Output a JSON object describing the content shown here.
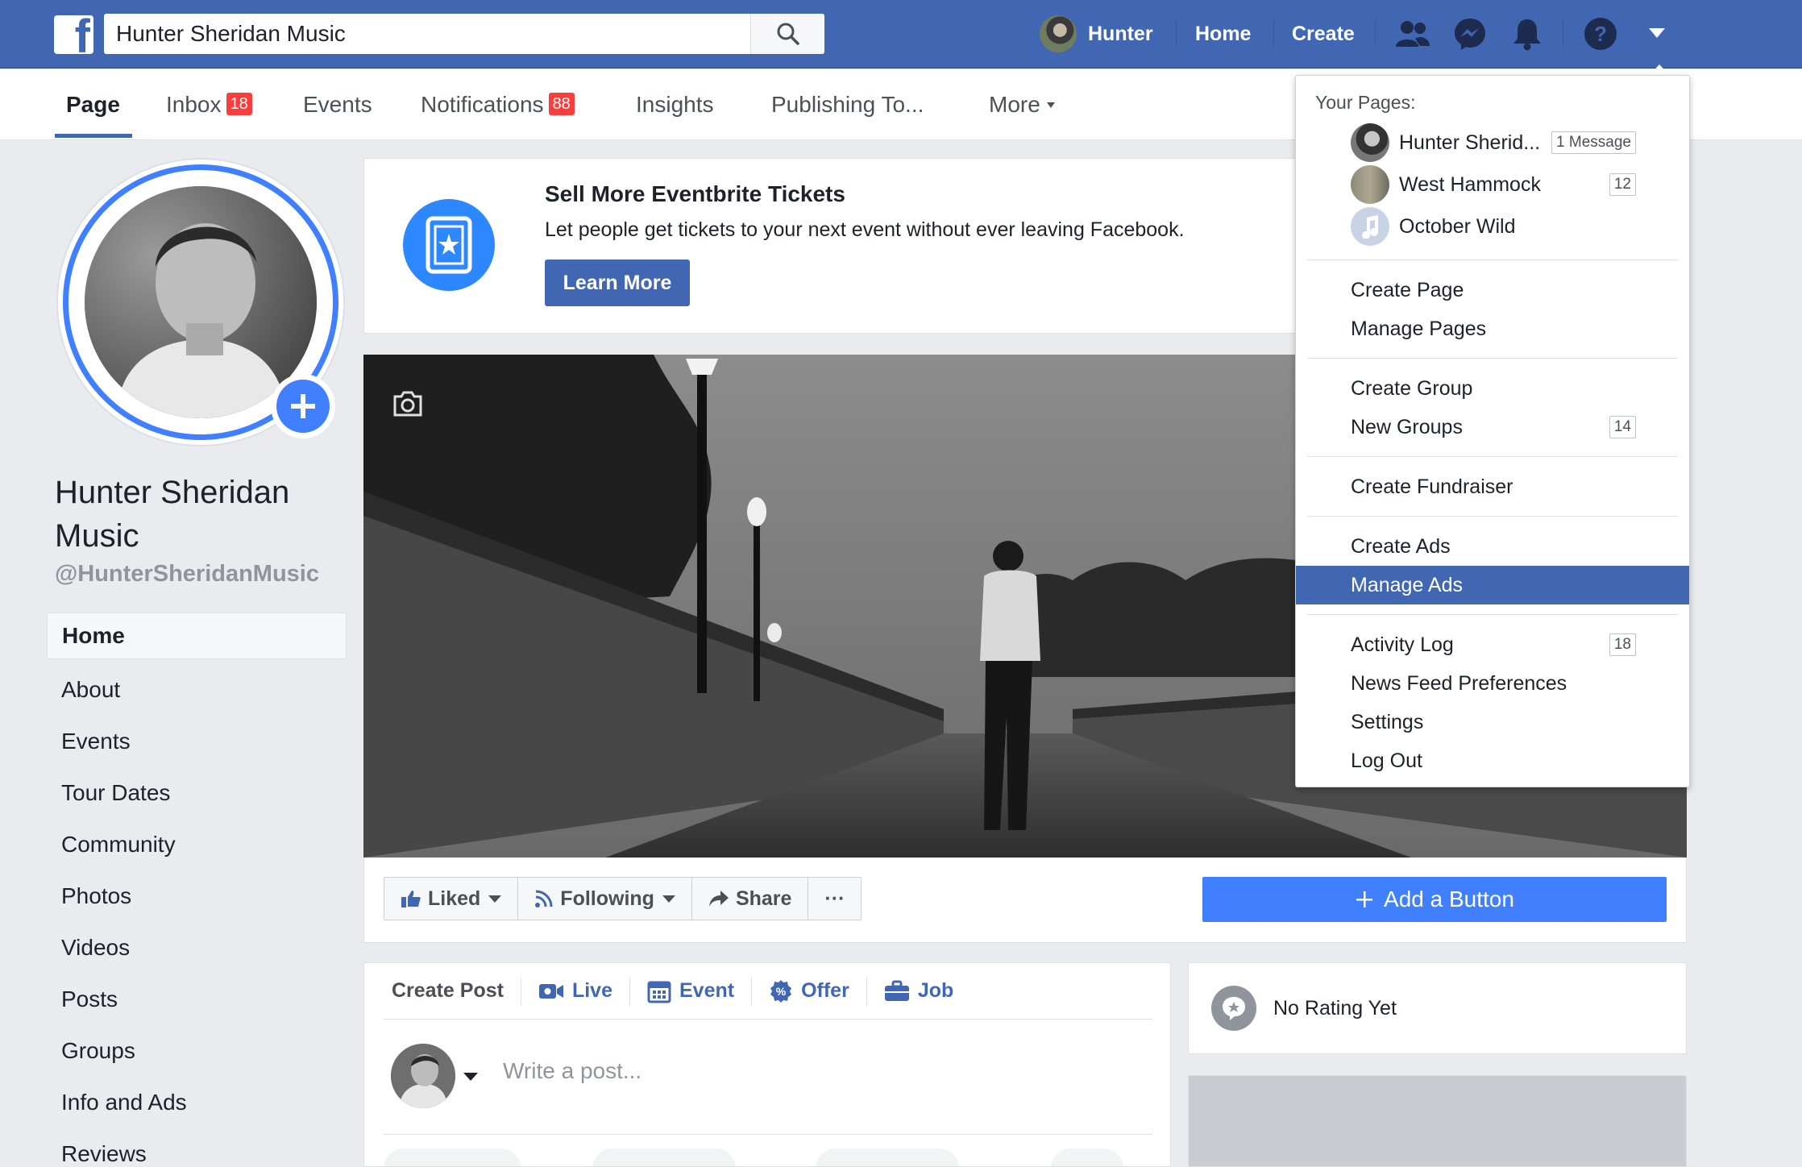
{
  "topbar": {
    "search_value": "Hunter Sheridan Music",
    "user_name": "Hunter",
    "home_label": "Home",
    "create_label": "Create"
  },
  "page_tabs": {
    "page": "Page",
    "inbox": "Inbox",
    "inbox_badge": "18",
    "events": "Events",
    "notifications": "Notifications",
    "notifications_badge": "88",
    "insights": "Insights",
    "publishing": "Publishing To...",
    "more": "More"
  },
  "profile": {
    "name": "Hunter Sheridan Music",
    "handle": "@HunterSheridanMusic"
  },
  "left_nav": [
    "Home",
    "About",
    "Events",
    "Tour Dates",
    "Community",
    "Photos",
    "Videos",
    "Posts",
    "Groups",
    "Info and Ads",
    "Reviews"
  ],
  "promo": {
    "title": "Sell More Eventbrite Tickets",
    "text": "Let people get tickets to your next event without ever leaving Facebook.",
    "button": "Learn More"
  },
  "actions": {
    "liked": "Liked",
    "following": "Following",
    "share": "Share",
    "more": "···",
    "add_button": "Add a Button"
  },
  "composer": {
    "tabs": [
      "Create Post",
      "Live",
      "Event",
      "Offer",
      "Job"
    ],
    "placeholder": "Write a post..."
  },
  "rating": {
    "text": "No Rating Yet"
  },
  "menu": {
    "header": "Your Pages:",
    "pages": [
      {
        "name": "Hunter Sherid...",
        "count": "1 Message"
      },
      {
        "name": "West Hammock",
        "count": "12"
      },
      {
        "name": "October Wild",
        "count": ""
      }
    ],
    "items": {
      "create_page": "Create Page",
      "manage_pages": "Manage Pages",
      "create_group": "Create Group",
      "new_groups": "New Groups",
      "new_groups_count": "14",
      "create_fundraiser": "Create Fundraiser",
      "create_ads": "Create Ads",
      "manage_ads": "Manage Ads",
      "activity_log": "Activity Log",
      "activity_log_count": "18",
      "news_feed_preferences": "News Feed Preferences",
      "settings": "Settings",
      "log_out": "Log Out"
    }
  },
  "colors": {
    "brand_blue": "#4267b2",
    "accent_blue": "#4080ff",
    "badge_red": "#fa3e3e",
    "page_bg": "#e9ebee"
  }
}
